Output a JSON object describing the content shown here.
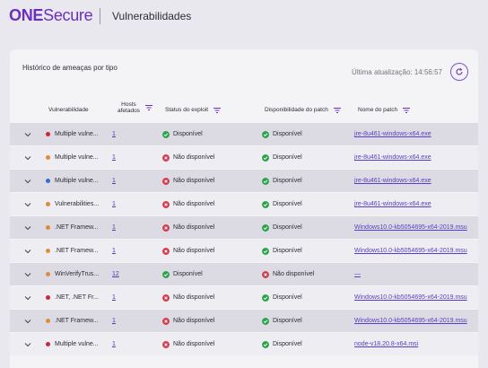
{
  "header": {
    "logo_bold": "ONE",
    "logo_rest": "Secure",
    "title": "Vulnerabilidades"
  },
  "card": {
    "title": "Histórico de ameaças por tipo",
    "updated": "Última atualização: 14:56:57"
  },
  "columns": {
    "vuln": "Vulnerabilidade",
    "hosts_line1": "Hosts",
    "hosts_line2": "afetados",
    "exploit": "Status do exploit",
    "patch_avail": "Disponibilidade do patch",
    "patch_name": "Nome do patch"
  },
  "colors": {
    "accent": "#6b2fbf",
    "ok": "#2aa34a",
    "bad": "#d13a4a",
    "sev_red": "#c8283c",
    "sev_orange": "#e08a3c",
    "sev_blue": "#2f6fd0"
  },
  "rows": [
    {
      "sev": "red",
      "name": "Multiple vulne...",
      "hosts": "1",
      "exploit": "Disponível",
      "exploit_ok": true,
      "patch": "Disponível",
      "patch_ok": true,
      "patch_name": "jre-8u461-windows-x64.exe"
    },
    {
      "sev": "orange",
      "name": "Multiple vulne...",
      "hosts": "1",
      "exploit": "Não disponível",
      "exploit_ok": false,
      "patch": "Disponível",
      "patch_ok": true,
      "patch_name": "jre-8u461-windows-x64.exe"
    },
    {
      "sev": "blue",
      "name": "Multiple vulne...",
      "hosts": "1",
      "exploit": "Não disponível",
      "exploit_ok": false,
      "patch": "Disponível",
      "patch_ok": true,
      "patch_name": "jre-8u461-windows-x64.exe"
    },
    {
      "sev": "orange",
      "name": "Vulnerabilities...",
      "hosts": "1",
      "exploit": "Não disponível",
      "exploit_ok": false,
      "patch": "Disponível",
      "patch_ok": true,
      "patch_name": "jre-8u461-windows-x64.exe"
    },
    {
      "sev": "orange",
      "name": ".NET Framew...",
      "hosts": "1",
      "exploit": "Não disponível",
      "exploit_ok": false,
      "patch": "Disponível",
      "patch_ok": true,
      "patch_name": "Windows10.0-kb5054695-x64-2019.msu"
    },
    {
      "sev": "orange",
      "name": ".NET Framew...",
      "hosts": "1",
      "exploit": "Não disponível",
      "exploit_ok": false,
      "patch": "Disponível",
      "patch_ok": true,
      "patch_name": "Windows10.0-kb5054695-x64-2019.msu"
    },
    {
      "sev": "orange",
      "name": "WinVerifyTrus...",
      "hosts": "12",
      "exploit": "Disponível",
      "exploit_ok": true,
      "patch": "Não disponível",
      "patch_ok": false,
      "patch_name": "—"
    },
    {
      "sev": "red",
      "name": ".NET, .NET Fr...",
      "hosts": "1",
      "exploit": "Não disponível",
      "exploit_ok": false,
      "patch": "Disponível",
      "patch_ok": true,
      "patch_name": "Windows10.0-kb5054695-x64-2019.msu"
    },
    {
      "sev": "orange",
      "name": ".NET Framew...",
      "hosts": "1",
      "exploit": "Não disponível",
      "exploit_ok": false,
      "patch": "Disponível",
      "patch_ok": true,
      "patch_name": "Windows10.0-kb5054695-x64-2019.msu"
    },
    {
      "sev": "red",
      "name": "Multiple vulne...",
      "hosts": "1",
      "exploit": "Não disponível",
      "exploit_ok": false,
      "patch": "Disponível",
      "patch_ok": true,
      "patch_name": "node-v18.20.8-x64.msi"
    }
  ]
}
